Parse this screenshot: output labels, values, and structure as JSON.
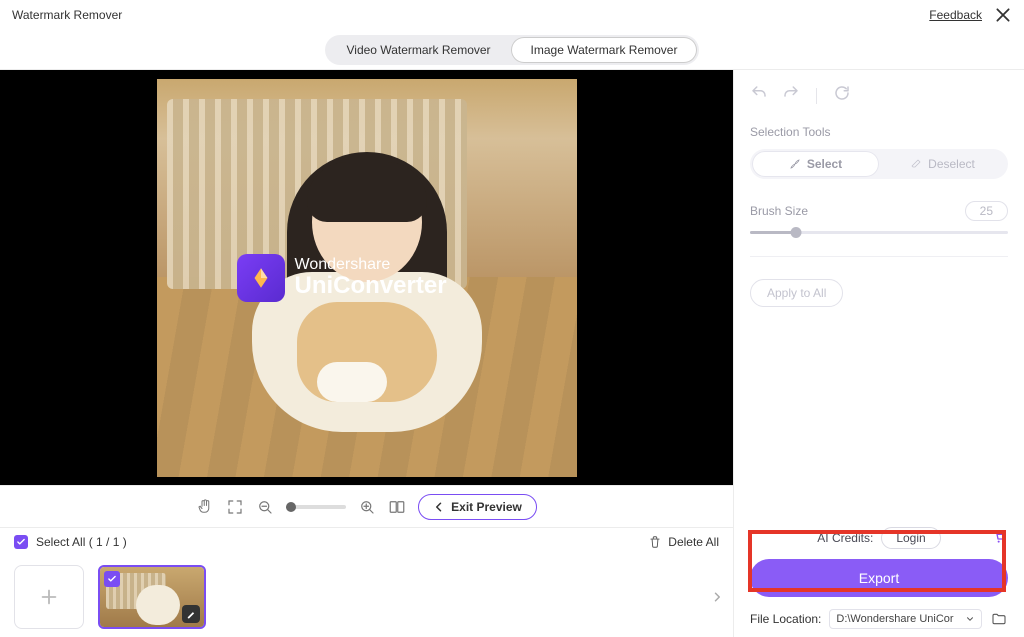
{
  "title": "Watermark Remover",
  "feedback": "Feedback",
  "tabs": {
    "video": "Video Watermark Remover",
    "image": "Image Watermark Remover"
  },
  "watermark": {
    "line1": "Wondershare",
    "line2": "UniConverter"
  },
  "toolbar": {
    "exit_preview": "Exit Preview"
  },
  "filmstrip": {
    "select_all": "Select All ( 1 / 1 )",
    "delete_all": "Delete All"
  },
  "sidebar": {
    "selection_tools_title": "Selection Tools",
    "select": "Select",
    "deselect": "Deselect",
    "brush_size_label": "Brush Size",
    "brush_size_value": "25",
    "apply_to_all": "Apply to All",
    "ai_credits": "AI Credits:",
    "login": "Login",
    "export": "Export",
    "file_location_label": "File Location:",
    "file_location_value": "D:\\Wondershare UniCor"
  }
}
